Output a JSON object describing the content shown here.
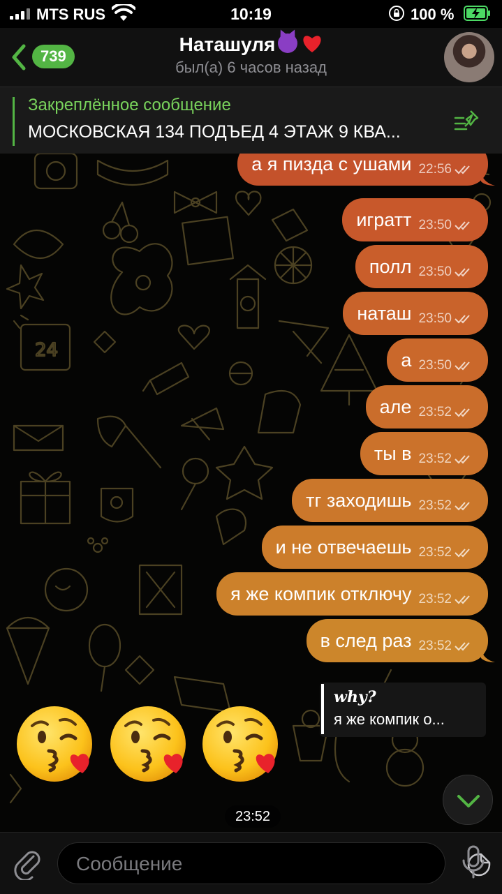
{
  "status_bar": {
    "carrier": "MTS RUS",
    "time": "10:19",
    "battery": "100 %",
    "icons": [
      "signal-icon",
      "wifi-icon",
      "orientation-lock-icon",
      "battery-charging-icon"
    ]
  },
  "header": {
    "back_badge": "739",
    "title": "Наташуля",
    "status": "был(а) 6 часов назад"
  },
  "pinned": {
    "title": "Закреплённое сообщение",
    "text": "МОСКОВСКАЯ 134 ПОДЪЕД 4 ЭТАЖ 9 КВА..."
  },
  "messages": [
    {
      "text": "а я пизда с ушами",
      "time": "22:56"
    },
    {
      "text": "игратт",
      "time": "23:50"
    },
    {
      "text": "полл",
      "time": "23:50"
    },
    {
      "text": "наташ",
      "time": "23:50"
    },
    {
      "text": "а",
      "time": "23:50"
    },
    {
      "text": "але",
      "time": "23:52"
    },
    {
      "text": "ты в",
      "time": "23:52"
    },
    {
      "text": "тг заходишь",
      "time": "23:52"
    },
    {
      "text": "и не отвечаешь",
      "time": "23:52"
    },
    {
      "text": "я же компик отключу",
      "time": "23:52"
    },
    {
      "text": "в след раз",
      "time": "23:52"
    }
  ],
  "reply": {
    "name": "𝒘𝒉𝒚?",
    "text": "я же компик о..."
  },
  "sticker": {
    "emoji": "face-blowing-kiss",
    "count": 3,
    "time": "23:52"
  },
  "input": {
    "placeholder": "Сообщение"
  },
  "colors": {
    "accent_green": "#53b544",
    "bubble_top": "#c8542a",
    "bubble_bottom": "#cc8a2a"
  }
}
